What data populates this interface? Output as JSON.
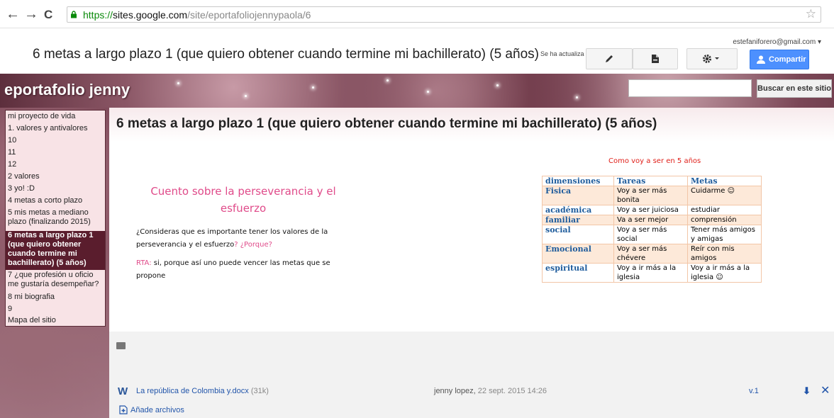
{
  "browser": {
    "back": "←",
    "forward": "→",
    "reload": "C",
    "url_protocol": "https://",
    "url_host": "sites.google.com",
    "url_path": "/site/eportafoliojennypaola/6",
    "star": "☆"
  },
  "topbar": {
    "page_title": "6 metas a largo plazo 1 (que quiero obtener cuando termine mi bachillerato) (5 años)",
    "updated": "Se ha actualizado",
    "email": "estefaniforero@gmail.com ▾",
    "share_label": "Compartir",
    "edit_icon": "pencil-icon",
    "page_icon": "new-page-icon",
    "settings_icon": "gear-icon"
  },
  "site": {
    "name": "eportafolio jenny",
    "search_placeholder": "",
    "search_button": "Buscar en este sitio"
  },
  "sidebar": {
    "items": [
      "mi proyecto de vida",
      "1. valores y antivalores",
      "10",
      "11",
      "12",
      "2 valores",
      "3 yo! :D",
      "4 metas a corto plazo",
      "5 mis metas a mediano",
      "plazo (finalizando 2015)"
    ],
    "active": [
      "6 metas a largo plazo 1",
      "(que quiero obtener",
      "cuando termine mi",
      "bachillerato) (5 años)"
    ],
    "after": [
      "7 ¿que profesión u oficio",
      "me gustaría desempeñar?",
      "8 mi biografia",
      "9",
      "Mapa del sitio"
    ]
  },
  "content": {
    "title": "6 metas a largo plazo 1 (que quiero obtener cuando termine mi bachillerato) (5 años)",
    "story_title": "Cuento sobre la perseverancia y el esfuerzo",
    "question_a": "¿Consideras que es importante tener los valores de la perseverancia y el esfuerzo",
    "question_b": "? ¿Porque",
    "question_c": "?",
    "answer_label": "RTA:",
    "answer_text": " si, porque así uno puede vencer las metas que se propone",
    "table_caption": "Como voy a ser en 5 años",
    "table_headers": [
      "dimensiones",
      "Tareas",
      "Metas"
    ],
    "table_rows": [
      [
        "Fisica",
        "Voy a ser más bonita",
        "Cuidarme ☺"
      ],
      [
        "académica",
        "Voy a ser juiciosa",
        "estudiar"
      ],
      [
        "familiar",
        "Va a ser mejor",
        "comprensión"
      ],
      [
        "social",
        "Voy a ser más social",
        "Tener más amigos y amigas"
      ],
      [
        "Emocional",
        "Voy a ser más chévere",
        "Reír con mis amigos"
      ],
      [
        "espiritual",
        "Voy a ir más a la iglesia",
        "Voy a ir más a la iglesia ☺"
      ]
    ]
  },
  "attachments": {
    "file_icon": "W",
    "file_name": "La república de Colombia y.docx",
    "file_size": " (31k)",
    "author": "jenny lopez,",
    "date": " 22 sept. 2015 14:26",
    "version": "v.1",
    "download": "⬇",
    "delete": "✕",
    "add_label": "Añade archivos"
  }
}
